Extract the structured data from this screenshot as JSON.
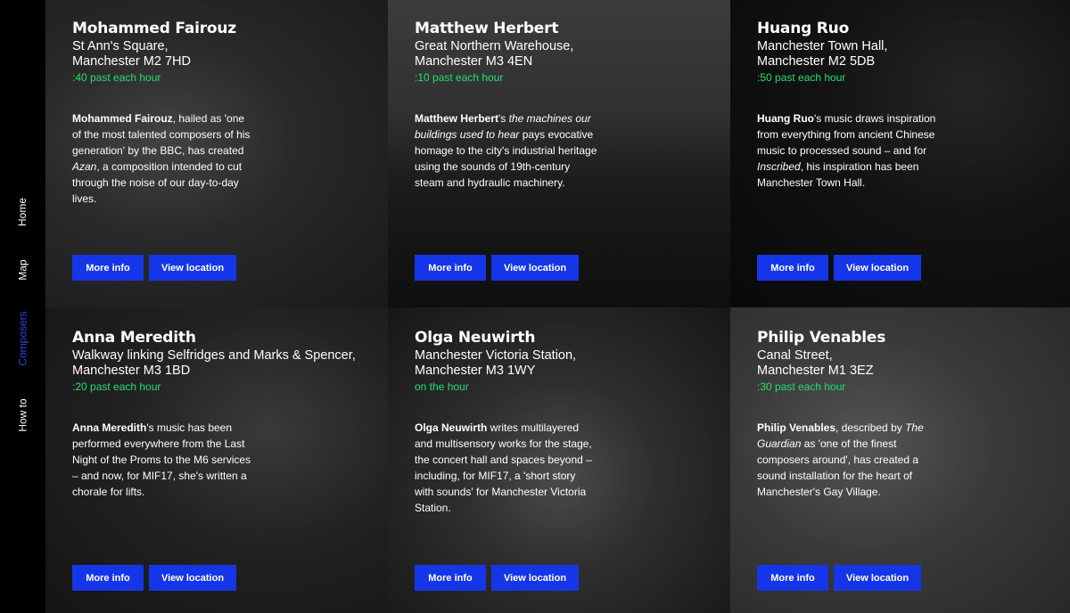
{
  "nav": {
    "items": [
      "Home",
      "Map",
      "Composers",
      "How to"
    ],
    "active": "Composers",
    "active_color": "#2f46e8"
  },
  "buttons": {
    "more_info": "More info",
    "view_location": "View location",
    "color": "#1536e8"
  },
  "time_color": "#22e06a",
  "composers": [
    {
      "name": "Mohammed Fairouz",
      "address_line1": "St Ann's Square,",
      "address_line2": "Manchester M2 7HD",
      "time": ":40 past each hour",
      "desc_bold": "Mohammed Fairouz",
      "desc_rest": ", hailed as 'one of the most talented composers of his generation' by the BBC, has created ",
      "desc_italic": "Azan",
      "desc_end": ", a composition intended to cut through the noise of our day-to-day lives.",
      "photo_tone": "#5a5a5a"
    },
    {
      "name": "Matthew Herbert",
      "address_line1": "Great Northern Warehouse,",
      "address_line2": "Manchester M3 4EN",
      "time": ":10 past each hour",
      "desc_bold": "Matthew Herbert",
      "desc_rest": "'s ",
      "desc_italic": "the machines our buildings used to hear",
      "desc_end": " pays evocative homage to the city's industrial heritage using the sounds of 19th-century steam and hydraulic machinery.",
      "photo_tone": "#4a4a4a"
    },
    {
      "name": "Huang Ruo",
      "address_line1": "Manchester Town Hall,",
      "address_line2": "Manchester M2 5DB",
      "time": ":50 past each hour",
      "desc_bold": "Huang Ruo",
      "desc_rest": "'s music draws inspiration from everything from ancient Chinese music to processed sound – and for ",
      "desc_italic": "Inscribed",
      "desc_end": ", his inspiration has been Manchester Town Hall.",
      "photo_tone": "#2a2a2a"
    },
    {
      "name": "Anna Meredith",
      "address_line1": "Walkway linking Selfridges and Marks & Spencer,",
      "address_line2": "Manchester M3 1BD",
      "time": ":20 past each hour",
      "desc_bold": "Anna Meredith",
      "desc_rest": "'s music has been performed everywhere from the Last Night of the Proms to the M6 services – and now, for MIF17, she's written a chorale for lifts.",
      "desc_italic": "",
      "desc_end": "",
      "photo_tone": "#3c3c3c"
    },
    {
      "name": "Olga Neuwirth",
      "address_line1": "Manchester Victoria Station,",
      "address_line2": "Manchester M3 1WY",
      "time": "on the hour",
      "desc_bold": "Olga Neuwirth",
      "desc_rest": " writes multilayered and multisensory works for the stage, the concert hall and spaces beyond – including, for MIF17, a 'short story with sounds' for Manchester Victoria Station.",
      "desc_italic": "",
      "desc_end": "",
      "photo_tone": "#6a6a6a"
    },
    {
      "name": "Philip Venables",
      "address_line1": "Canal Street,",
      "address_line2": "Manchester M1 3EZ",
      "time": ":30 past each hour",
      "desc_bold": "Philip Venables",
      "desc_rest": ", described by ",
      "desc_italic": "The Guardian",
      "desc_end": " as 'one of the finest composers around', has created a sound installation for the heart of Manchester's Gay Village.",
      "photo_tone": "#777777"
    }
  ]
}
